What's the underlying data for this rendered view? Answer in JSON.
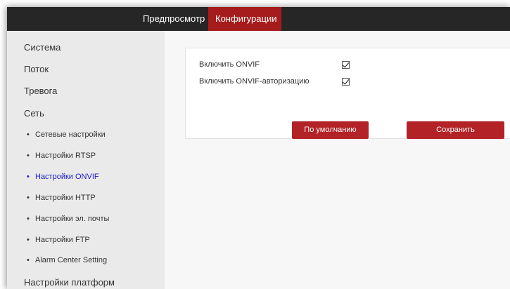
{
  "topnav": {
    "tabs": [
      {
        "label": "Предпросмотр",
        "active": false
      },
      {
        "label": "Конфигурации",
        "active": true
      }
    ]
  },
  "sidebar": {
    "items": [
      {
        "label": "Система"
      },
      {
        "label": "Поток"
      },
      {
        "label": "Тревога"
      },
      {
        "label": "Сеть"
      }
    ],
    "subitems": [
      {
        "label": "Сетевые настройки",
        "active": false
      },
      {
        "label": "Настройки RTSP",
        "active": false
      },
      {
        "label": "Настройки ONVIF",
        "active": true
      },
      {
        "label": "Настройки HTTP",
        "active": false
      },
      {
        "label": "Настройки эл. почты",
        "active": false
      },
      {
        "label": "Настройки FTP",
        "active": false
      },
      {
        "label": "Alarm Center Setting",
        "active": false
      }
    ],
    "last_item": {
      "label": "Настройки платформ"
    },
    "bullet": "•"
  },
  "form": {
    "enable_onvif": {
      "label": "Включить ONVIF",
      "checked": true
    },
    "enable_onvif_auth": {
      "label": "Включить ONVIF-авторизацию",
      "checked": true
    },
    "default_button": "По умолчанию",
    "save_button": "Сохранить"
  },
  "colors": {
    "accent": "#a61c1c",
    "button": "#b22226",
    "topbar": "#262626",
    "active_link": "#1a1acd"
  }
}
